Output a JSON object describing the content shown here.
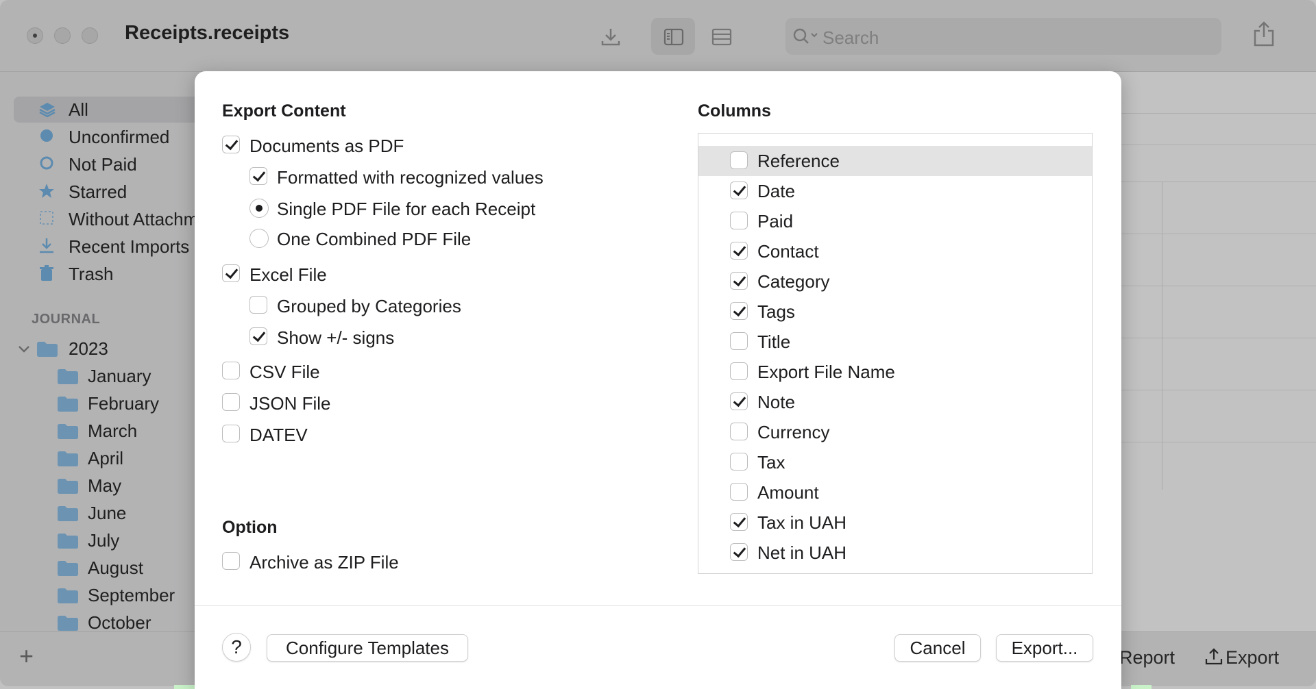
{
  "window": {
    "title": "Receipts.receipts",
    "search_placeholder": "Search"
  },
  "sidebar": {
    "items": [
      {
        "label": "All",
        "icon": "stack-icon"
      },
      {
        "label": "Unconfirmed",
        "icon": "filled-circle-icon"
      },
      {
        "label": "Not Paid",
        "icon": "open-circle-icon"
      },
      {
        "label": "Starred",
        "icon": "star-icon"
      },
      {
        "label": "Without Attachm",
        "icon": "dashed-square-icon"
      },
      {
        "label": "Recent Imports",
        "icon": "download-icon"
      },
      {
        "label": "Trash",
        "icon": "trash-icon"
      }
    ],
    "journal_header": "JOURNAL",
    "year": "2023",
    "months": [
      "January",
      "February",
      "March",
      "April",
      "May",
      "June",
      "July",
      "August",
      "September",
      "October"
    ]
  },
  "bottombar": {
    "report": "Report",
    "export": "Export"
  },
  "dialog": {
    "export_content_title": "Export Content",
    "options": {
      "documents_pdf": {
        "label": "Documents as PDF",
        "checked": true
      },
      "formatted": {
        "label": "Formatted with recognized values",
        "checked": true
      },
      "single_pdf": {
        "label": "Single PDF File for each Receipt",
        "selected": true
      },
      "combined_pdf": {
        "label": "One Combined PDF File",
        "selected": false
      },
      "excel": {
        "label": "Excel File",
        "checked": true
      },
      "grouped": {
        "label": "Grouped by Categories",
        "checked": false
      },
      "signs": {
        "label": "Show +/- signs",
        "checked": true
      },
      "csv": {
        "label": "CSV File",
        "checked": false
      },
      "json": {
        "label": "JSON File",
        "checked": false
      },
      "datev": {
        "label": "DATEV",
        "checked": false
      }
    },
    "option_title": "Option",
    "archive_zip": {
      "label": "Archive as ZIP File",
      "checked": false
    },
    "columns_title": "Columns",
    "columns": [
      {
        "label": "Reference",
        "checked": false
      },
      {
        "label": "Date",
        "checked": true
      },
      {
        "label": "Paid",
        "checked": false
      },
      {
        "label": "Contact",
        "checked": true
      },
      {
        "label": "Category",
        "checked": true
      },
      {
        "label": "Tags",
        "checked": true
      },
      {
        "label": "Title",
        "checked": false
      },
      {
        "label": "Export File Name",
        "checked": false
      },
      {
        "label": "Note",
        "checked": true
      },
      {
        "label": "Currency",
        "checked": false
      },
      {
        "label": "Tax",
        "checked": false
      },
      {
        "label": "Amount",
        "checked": false
      },
      {
        "label": "Tax in UAH",
        "checked": true
      },
      {
        "label": "Net in UAH",
        "checked": true
      }
    ],
    "buttons": {
      "help": "?",
      "configure": "Configure Templates",
      "cancel": "Cancel",
      "export": "Export..."
    }
  }
}
